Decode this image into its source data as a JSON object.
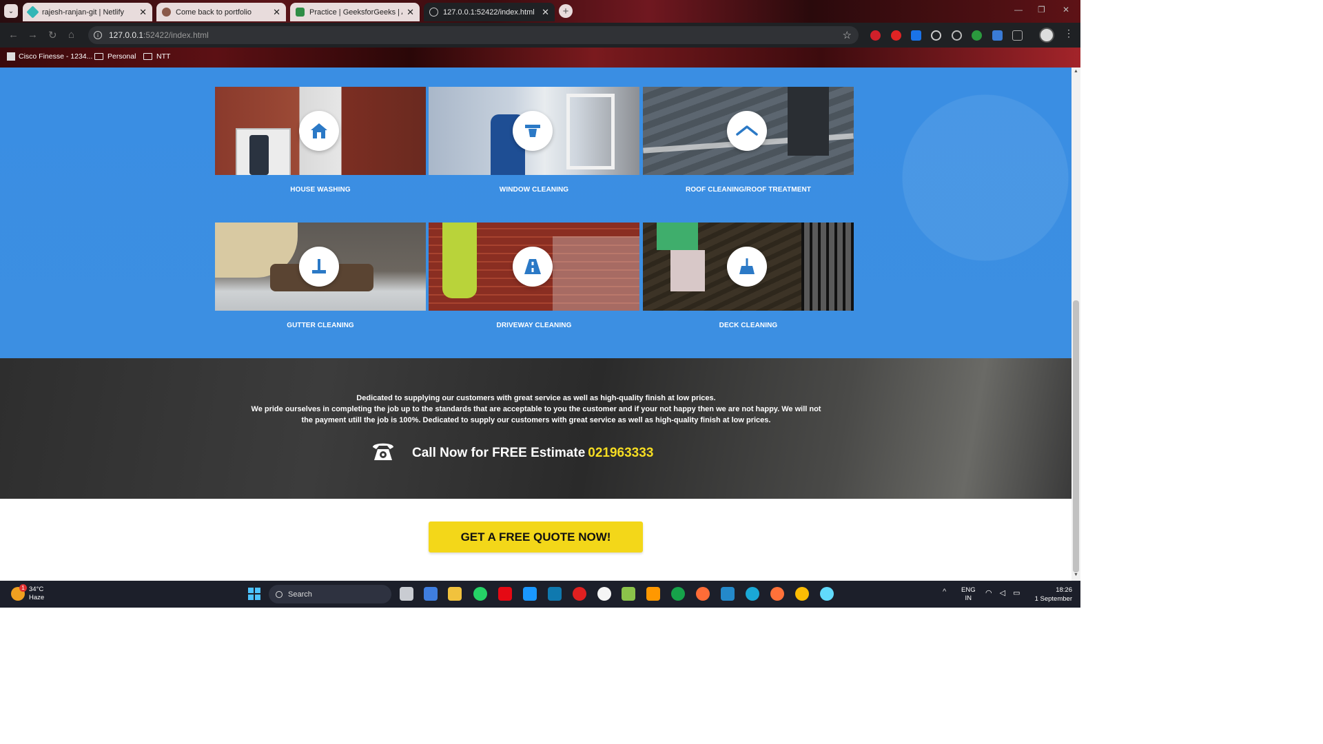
{
  "browser": {
    "tabs": [
      {
        "title": "rajesh-ranjan-git | Netlify",
        "favicon_color": "#32b6b6",
        "active": false
      },
      {
        "title": "Come back to portfolio",
        "favicon_color": "#8a5a4a",
        "active": false
      },
      {
        "title": "Practice | GeeksforGeeks | A co",
        "favicon_color": "#2f8d46",
        "active": false
      },
      {
        "title": "127.0.0.1:52422/index.html",
        "favicon_color": "#cccccc",
        "active": true
      }
    ],
    "url_host": "127.0.0.1",
    "url_rest": ":52422/index.html",
    "bookmarks": [
      {
        "label": "Cisco Finesse - 1234..."
      },
      {
        "label": "Personal"
      },
      {
        "label": "NTT"
      }
    ]
  },
  "services": [
    {
      "label": "HOUSE WASHING",
      "icon": "house-icon"
    },
    {
      "label": "WINDOW CLEANING",
      "icon": "squeegee-icon"
    },
    {
      "label": "ROOF CLEANING/ROOF TREATMENT",
      "icon": "roof-icon"
    },
    {
      "label": "GUTTER CLEANING",
      "icon": "gutter-tool-icon"
    },
    {
      "label": "DRIVEWAY CLEANING",
      "icon": "road-icon"
    },
    {
      "label": "DECK CLEANING",
      "icon": "broom-icon"
    }
  ],
  "cta": {
    "line1": "Dedicated to supplying our customers with great service as well as high-quality finish at low prices.",
    "line2": "We pride ourselves in completing the job up to the standards that are acceptable to you the customer and if your not happy then we are not happy. We will not the payment utill the job is 100%. Dedicated to supply our customers with great service as well as high-quality finish at low prices.",
    "call_text": "Call Now for FREE Estimate",
    "phone": "021963333",
    "phone_color": "#f5dc22"
  },
  "quote_button": "GET A FREE QUOTE NOW!",
  "taskbar": {
    "weather_temp": "34°C",
    "weather_desc": "Haze",
    "weather_badge": "1",
    "search": "Search",
    "lang1": "ENG",
    "lang2": "IN",
    "time": "18:26",
    "date": "1 September"
  },
  "colors": {
    "services_bg": "#3a8ee3",
    "quote_button": "#f3d719"
  }
}
